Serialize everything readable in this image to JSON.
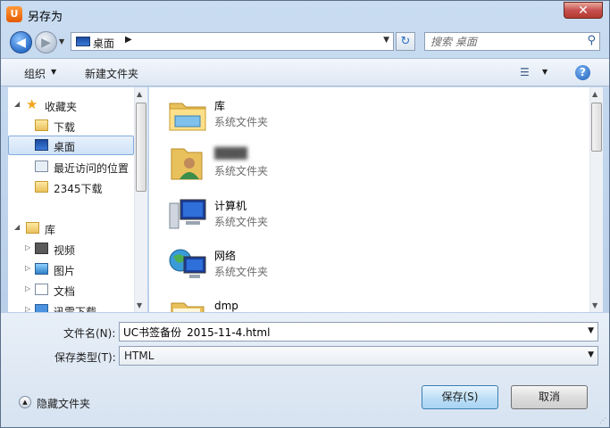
{
  "window": {
    "title": "另存为",
    "close_label": "✕"
  },
  "nav": {
    "address_location": "桌面",
    "search_placeholder": "搜索 桌面"
  },
  "toolbar": {
    "organize_label": "组织",
    "new_folder_label": "新建文件夹"
  },
  "sidebar": {
    "favorites": {
      "label": "收藏夹"
    },
    "items": [
      {
        "label": "下载",
        "icon": "download-folder-icon"
      },
      {
        "label": "桌面",
        "icon": "desktop-icon",
        "selected": true
      },
      {
        "label": "最近访问的位置",
        "icon": "recent-places-icon"
      },
      {
        "label": "2345下载",
        "icon": "folder-icon"
      }
    ],
    "libraries": {
      "label": "库"
    },
    "library_items": [
      {
        "label": "视频",
        "icon": "video-library-icon"
      },
      {
        "label": "图片",
        "icon": "pictures-library-icon"
      },
      {
        "label": "文档",
        "icon": "documents-library-icon"
      },
      {
        "label": "迅雷下载",
        "icon": "thunder-download-icon"
      }
    ]
  },
  "files": [
    {
      "name": "库",
      "type": "系统文件夹",
      "icon": "library-folder-icon"
    },
    {
      "name": "████",
      "type": "系统文件夹",
      "icon": "user-folder-icon",
      "blurred": true
    },
    {
      "name": "计算机",
      "type": "系统文件夹",
      "icon": "computer-icon"
    },
    {
      "name": "网络",
      "type": "系统文件夹",
      "icon": "network-icon"
    },
    {
      "name": "dmp",
      "type": "",
      "icon": "folder-icon"
    }
  ],
  "form": {
    "filename_label": "文件名(N):",
    "filename_value": "UC书签备份_2015-11-4.html",
    "type_label": "保存类型(T):",
    "type_value": "HTML"
  },
  "footer": {
    "hide_folders_label": "隐藏文件夹",
    "save_label": "保存(S)",
    "cancel_label": "取消"
  }
}
